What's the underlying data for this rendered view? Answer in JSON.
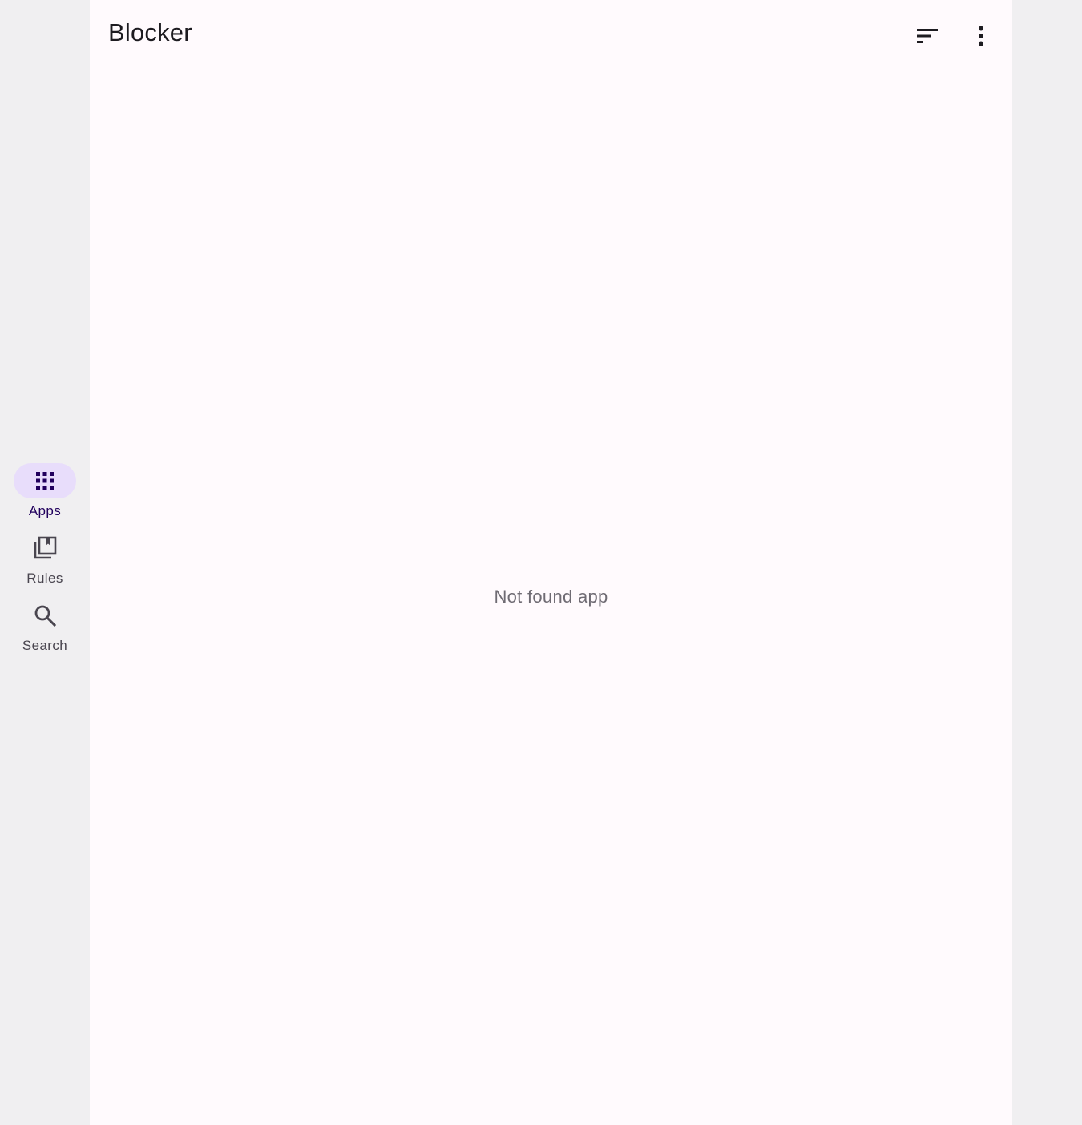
{
  "app": {
    "title": "Blocker"
  },
  "toolbar": {
    "sort_icon": "sort-icon",
    "more_icon": "more-vert-icon"
  },
  "nav": {
    "items": [
      {
        "label": "Apps",
        "icon": "apps-grid-icon",
        "active": true
      },
      {
        "label": "Rules",
        "icon": "rules-library-icon",
        "active": false
      },
      {
        "label": "Search",
        "icon": "search-icon",
        "active": false
      }
    ]
  },
  "main": {
    "empty_message": "Not found app"
  },
  "colors": {
    "background": "#f0eff1",
    "surface": "#fffafd",
    "active_indicator": "#e8ddfb",
    "active_label": "#21005d",
    "inactive_label": "#49454f"
  }
}
